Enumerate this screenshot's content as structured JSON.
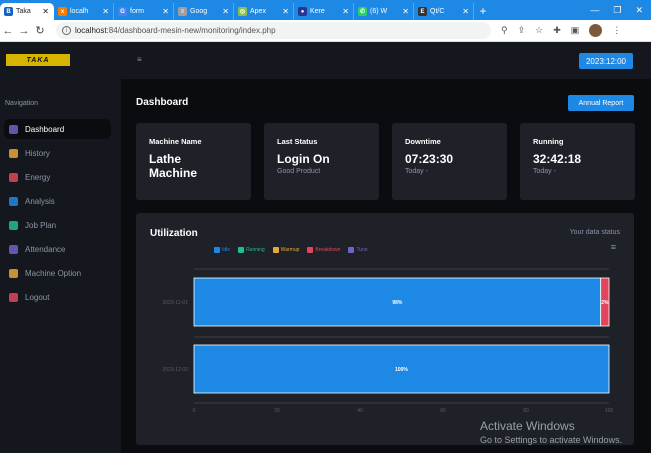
{
  "browser": {
    "tabs": [
      {
        "label": "Taka",
        "icon": "b-logo-icon",
        "color": "#1565c0",
        "glyph": "B"
      },
      {
        "label": "localh",
        "icon": "xampp-icon",
        "color": "#f57c00",
        "glyph": "x"
      },
      {
        "label": "form",
        "icon": "google-icon",
        "color": "#4285f4",
        "glyph": "G"
      },
      {
        "label": "Goog",
        "icon": "google-search-icon",
        "color": "#9e9e9e",
        "glyph": "≡"
      },
      {
        "label": "Apex",
        "icon": "apex-icon",
        "color": "#8bc34a",
        "glyph": "◎"
      },
      {
        "label": "Kere",
        "icon": "globe-icon",
        "color": "#283593",
        "glyph": "●"
      },
      {
        "label": "(6) W",
        "icon": "whatsapp-icon",
        "color": "#25d366",
        "glyph": "✆"
      },
      {
        "label": "Qt/C",
        "icon": "e-icon",
        "color": "#333333",
        "glyph": "E"
      }
    ],
    "url_host": "localhost",
    "url_path": ":84/dashboard-mesin-new/monitoring/index.php"
  },
  "app": {
    "brand": "TAKA",
    "nav_label": "Navigation",
    "nav_items": [
      {
        "label": "Dashboard",
        "icon": "dashboard-icon",
        "color": "#6f63c9",
        "active": true
      },
      {
        "label": "History",
        "icon": "history-icon",
        "color": "#e8a838",
        "active": false
      },
      {
        "label": "Energy",
        "icon": "energy-icon",
        "color": "#e0455c",
        "active": false
      },
      {
        "label": "Analysis",
        "icon": "analysis-icon",
        "color": "#1e88e5",
        "active": false
      },
      {
        "label": "Job Plan",
        "icon": "job-plan-icon",
        "color": "#1fbf8f",
        "active": false
      },
      {
        "label": "Attendance",
        "icon": "attendance-icon",
        "color": "#6f63c9",
        "active": false
      },
      {
        "label": "Machine Option",
        "icon": "machine-option-icon",
        "color": "#e8a838",
        "active": false
      },
      {
        "label": "Logout",
        "icon": "logout-icon",
        "color": "#e0455c",
        "active": false
      }
    ],
    "date_badge": "2023:12:00",
    "page_title": "Dashboard",
    "report_button": "Annual Report",
    "cards": [
      {
        "label": "Machine Name",
        "value": "Lathe Machine",
        "sub": ""
      },
      {
        "label": "Last Status",
        "value": "Login On",
        "sub": "Good Product"
      },
      {
        "label": "Downtime",
        "value": "07:23:30",
        "sub": "Today -"
      },
      {
        "label": "Running",
        "value": "32:42:18",
        "sub": "Today -"
      }
    ],
    "utilization_title": "Utilization",
    "utilization_status": "Your data status"
  },
  "chart_data": {
    "type": "bar",
    "orientation": "horizontal",
    "stacked": true,
    "categories": [
      "2023-12-01",
      "2023-12-02"
    ],
    "legend": [
      {
        "name": "Idle",
        "color": "#1e88e5"
      },
      {
        "name": "Running",
        "color": "#1fbf8f"
      },
      {
        "name": "Warmup",
        "color": "#e8a838"
      },
      {
        "name": "Breakdown",
        "color": "#e0455c"
      },
      {
        "name": "Tune",
        "color": "#6f63c9"
      }
    ],
    "series": [
      {
        "name": "Idle",
        "values": [
          98,
          100
        ],
        "labels": [
          "98%",
          "100%"
        ]
      },
      {
        "name": "Breakdown",
        "values": [
          2,
          0
        ],
        "labels": [
          "2%",
          ""
        ]
      }
    ],
    "xticks": [
      "0",
      "20",
      "40",
      "60",
      "80",
      "100"
    ],
    "xlim": [
      0,
      100
    ]
  },
  "os": {
    "watermark": "Activate Windows",
    "watermark_sub": "Go to Settings to activate Windows."
  }
}
